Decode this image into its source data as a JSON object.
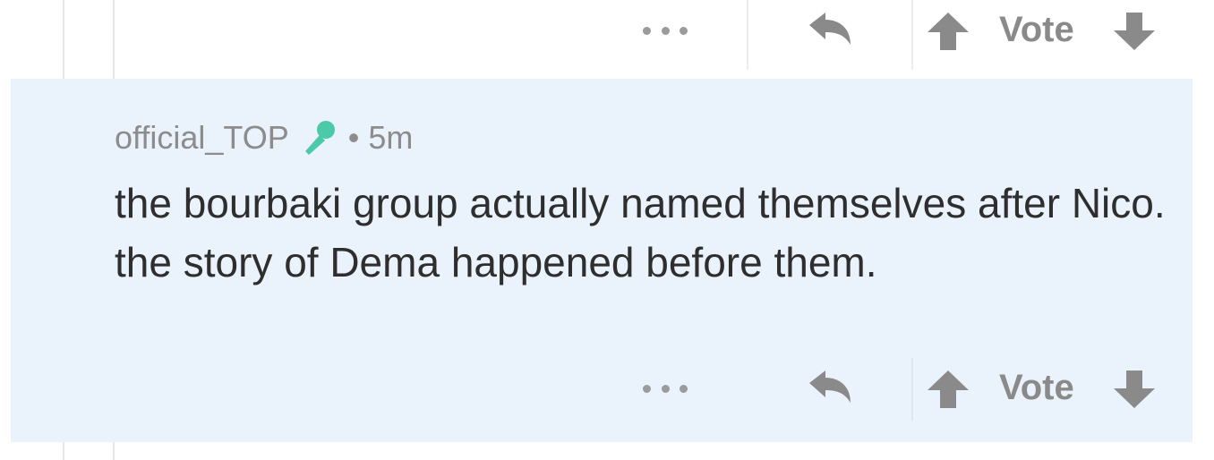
{
  "top_actions": {
    "vote_label": "Vote"
  },
  "comment": {
    "username": "official_TOP",
    "separator": "•",
    "time": "5m",
    "body": "the bourbaki group actually named themselves after Nico. the story of Dema happened before them.",
    "actions": {
      "vote_label": "Vote"
    }
  },
  "icons": {
    "more": "more-dots-icon",
    "reply": "reply-arrow-icon",
    "upvote": "upvote-arrow-icon",
    "downvote": "downvote-arrow-icon",
    "badge": "microphone-icon"
  },
  "colors": {
    "highlight_background": "#eaf2fc",
    "icon_gray": "#8a8a8a",
    "badge_teal": "#4cc9a8",
    "text_dark": "#2e2e2e",
    "meta_gray": "#8c8c8c"
  }
}
